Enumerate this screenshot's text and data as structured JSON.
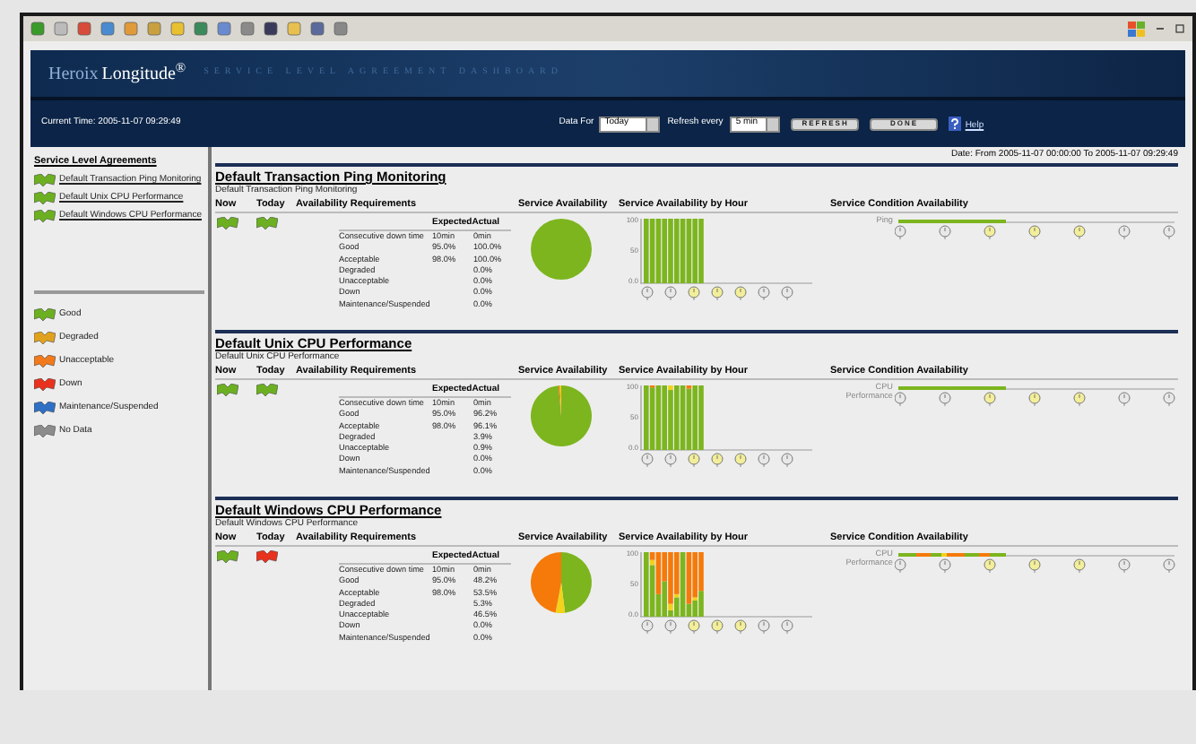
{
  "header": {
    "logo_prefix": "Heroix",
    "logo_name": "Longitude$^{®}$",
    "tagline": "SERVICE LEVEL AGREEMENT DASHBOARD",
    "current_time": "Current Time: 2005-11-07 09:29:49",
    "data_for": {
      "label": "Data For",
      "value": "Today"
    },
    "refresh": {
      "label": "Refresh every",
      "value": "5 min"
    },
    "buttons": [
      "REFRESH",
      "DONE"
    ],
    "help": "Help"
  },
  "sidebar": {
    "title": "Service Level Agreements",
    "items": [
      {
        "label": "Default Transaction Ping Monitoring",
        "color": "#6cb022"
      },
      {
        "label": "Default Unix CPU Performance",
        "color": "#6cb022"
      },
      {
        "label": "Default Windows CPU Performance",
        "color": "#6cb022"
      }
    ],
    "legend": [
      {
        "label": "Good",
        "color": "#6cb022"
      },
      {
        "label": "Degraded",
        "color": "#e0a21e"
      },
      {
        "label": "Unacceptable",
        "color": "#f07a1c"
      },
      {
        "label": "Down",
        "color": "#e8321e"
      },
      {
        "label": "Maintenance/Suspended",
        "color": "#2f6fc4"
      },
      {
        "label": "No Data",
        "color": "#8c8c8c"
      }
    ]
  },
  "main": {
    "date": "Date: From 2005-11-07 00:00:00 To 2005-11-07 09:29:49",
    "sections": [
      {
        "title": "Default Transaction Ping Monitoring",
        "subtitle": "Default Transaction Ping Monitoring",
        "columns": [
          "Now",
          "Today",
          "Availability Requirements",
          "Service Availability",
          "Service Availability by Hour",
          "Service Condition Availability"
        ],
        "now": {
          "color": "#6cb022"
        },
        "today": {
          "color": "#6cb022"
        },
        "table_columns": [
          "Expected",
          "Actual"
        ],
        "rows": [
          {
            "label": "Consecutive down time",
            "expected": "10min",
            "actual": "0min"
          },
          {
            "label": "Good",
            "expected": "95.0%",
            "actual": "100.0%"
          },
          {
            "label": "Acceptable",
            "expected": "98.0%",
            "actual": "100.0%"
          },
          {
            "label": "Degraded",
            "actual": "0.0%"
          },
          {
            "label": "Unacceptable",
            "actual": "0.0%"
          },
          {
            "label": "Down",
            "actual": "0.0%"
          },
          {
            "label": "Maintenance/Suspended",
            "actual": "0.0%"
          }
        ],
        "ticks": [
          "100",
          "50",
          "0.0"
        ],
        "condition_label": "Ping"
      },
      {
        "title": "Default Unix CPU Performance",
        "subtitle": "Default Unix CPU Performance",
        "columns": [
          "Now",
          "Today",
          "Availability Requirements",
          "Service Availability",
          "Service Availability by Hour",
          "Service Condition Availability"
        ],
        "now": {
          "color": "#6cb022"
        },
        "today": {
          "color": "#6cb022"
        },
        "table_columns": [
          "Expected",
          "Actual"
        ],
        "rows": [
          {
            "label": "Consecutive down time",
            "expected": "10min",
            "actual": "0min"
          },
          {
            "label": "Good",
            "expected": "95.0%",
            "actual": "96.2%"
          },
          {
            "label": "Acceptable",
            "expected": "98.0%",
            "actual": "96.1%"
          },
          {
            "label": "Degraded",
            "actual": "3.9%"
          },
          {
            "label": "Unacceptable",
            "actual": "0.9%"
          },
          {
            "label": "Down",
            "actual": "0.0%"
          },
          {
            "label": "Maintenance/Suspended",
            "actual": "0.0%"
          }
        ],
        "ticks": [
          "100",
          "50",
          "0.0"
        ],
        "condition_label": "CPU Performance"
      },
      {
        "title": "Default Windows CPU Performance",
        "subtitle": "Default Windows CPU Performance",
        "columns": [
          "Now",
          "Today",
          "Availability Requirements",
          "Service Availability",
          "Service Availability by Hour",
          "Service Condition Availability"
        ],
        "now": {
          "color": "#6cb022"
        },
        "today": {
          "color": "#e8321e"
        },
        "table_columns": [
          "Expected",
          "Actual"
        ],
        "rows": [
          {
            "label": "Consecutive down time",
            "expected": "10min",
            "actual": "0min"
          },
          {
            "label": "Good",
            "expected": "95.0%",
            "actual": "48.2%"
          },
          {
            "label": "Acceptable",
            "expected": "98.0%",
            "actual": "53.5%"
          },
          {
            "label": "Degraded",
            "actual": "5.3%"
          },
          {
            "label": "Unacceptable",
            "actual": "46.5%"
          },
          {
            "label": "Down",
            "actual": "0.0%"
          },
          {
            "label": "Maintenance/Suspended",
            "actual": "0.0%"
          }
        ],
        "ticks": [
          "100",
          "50",
          "0.0"
        ],
        "condition_label": "CPU Performance"
      }
    ]
  }
}
